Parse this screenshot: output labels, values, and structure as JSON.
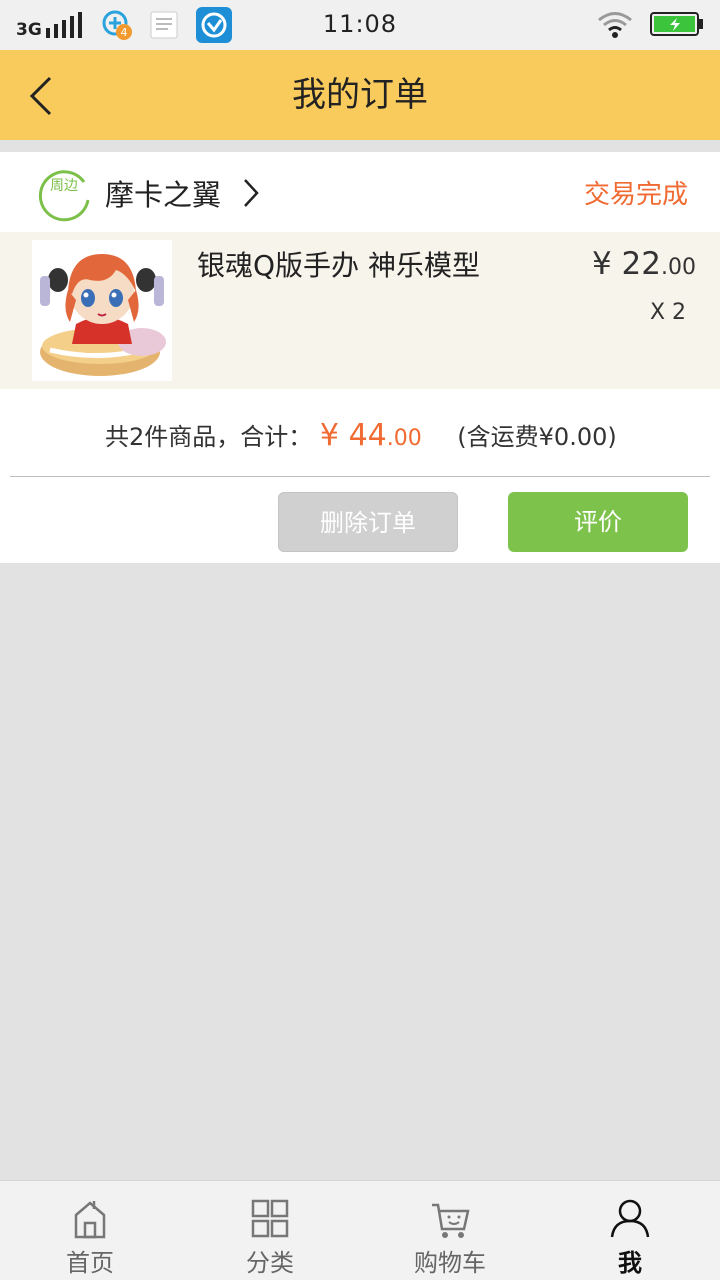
{
  "status_bar": {
    "network": "3G",
    "notification_count": "4",
    "time": "11:08"
  },
  "header": {
    "title": "我的订单",
    "back_icon": "chevron-left-icon"
  },
  "order": {
    "store_badge": "周边",
    "store_name": "摩卡之翼",
    "status": "交易完成",
    "product": {
      "name": "银魂Q版手办 神乐模型",
      "price_currency": "¥",
      "price_main": "22",
      "price_cents": ".00",
      "quantity": "X 2"
    },
    "summary": {
      "count_text": "共2件商品，合计：",
      "total_currency": "¥",
      "total_main": "44",
      "total_cents": ".00",
      "shipping_text": "(含运费¥0.00)"
    },
    "buttons": {
      "delete": "删除订单",
      "review": "评价"
    }
  },
  "colors": {
    "header_bg": "#f8cb5c",
    "accent_orange": "#f06a32",
    "green": "#7dc34b",
    "product_bg": "#f7f4ec"
  },
  "bottom_nav": {
    "items": [
      {
        "label": "首页",
        "icon": "home-icon"
      },
      {
        "label": "分类",
        "icon": "grid-icon"
      },
      {
        "label": "购物车",
        "icon": "cart-icon"
      },
      {
        "label": "我",
        "icon": "person-icon",
        "active": true
      }
    ]
  }
}
